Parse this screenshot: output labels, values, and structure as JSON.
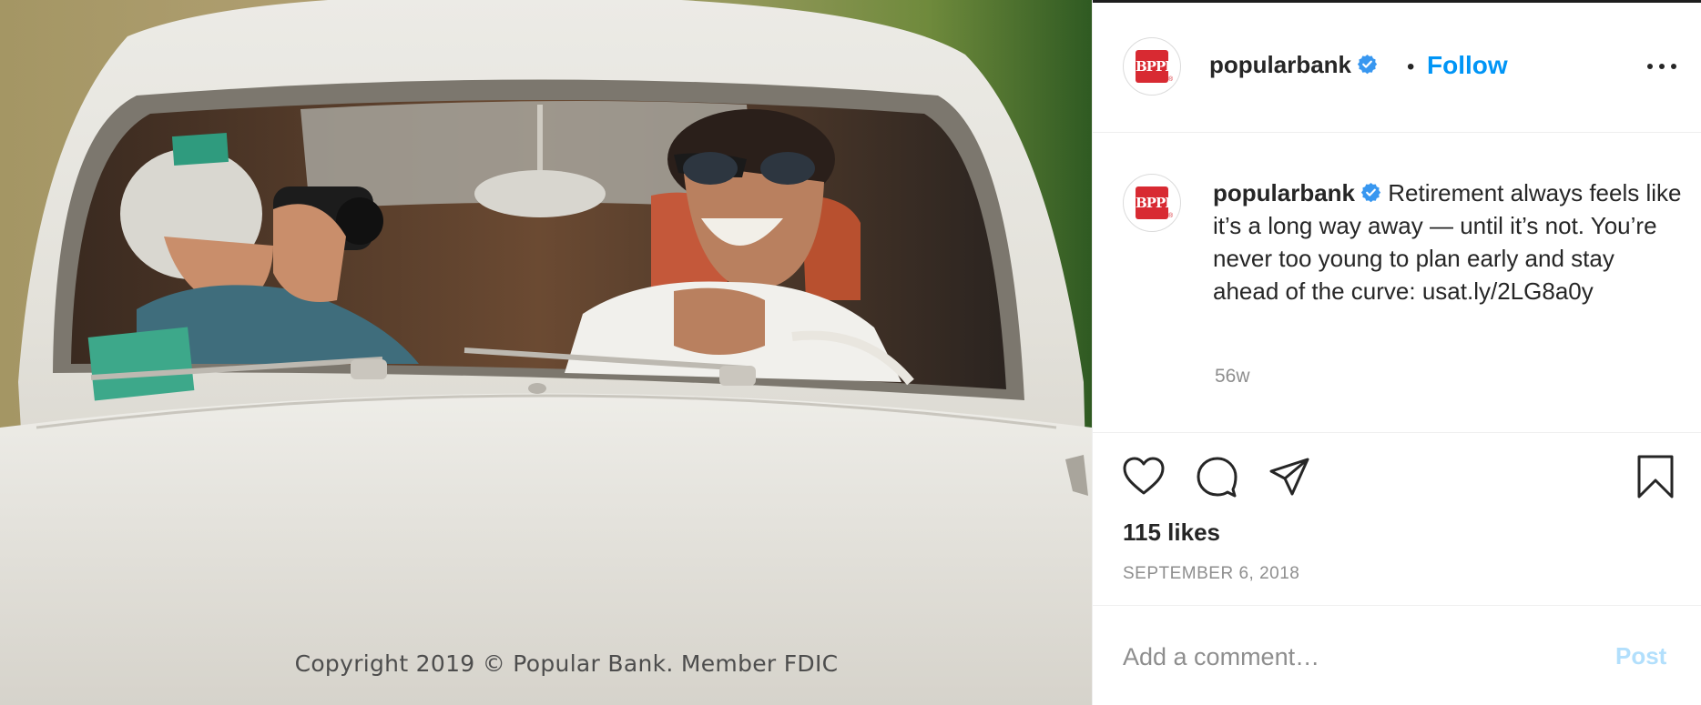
{
  "photo": {
    "caption": "Copyright 2019 © Popular Bank. Member FDIC"
  },
  "account": {
    "username": "popularbank",
    "logo_text": "BPPR",
    "logo_reg": "®",
    "verified": true,
    "follow_label": "Follow",
    "separator": "•"
  },
  "caption": {
    "username": "popularbank",
    "text": "Retirement always feels like it’s a long way away — until it’s not. You’re never too young to plan early and stay ahead of the curve:",
    "link": "usat.ly/2LG8a0y",
    "age": "56w"
  },
  "actions": {
    "icons": [
      "heart-icon",
      "comment-icon",
      "share-icon",
      "bookmark-icon"
    ],
    "likes": "115 likes",
    "date": "SEPTEMBER 6, 2018"
  },
  "comment": {
    "placeholder": "Add a comment…",
    "post_label": "Post"
  },
  "colors": {
    "accent": "#0095f6",
    "post_disabled": "#b2dffc",
    "brand_red": "#d82a32",
    "verified": "#3897f0",
    "muted": "#8e8e8e"
  }
}
